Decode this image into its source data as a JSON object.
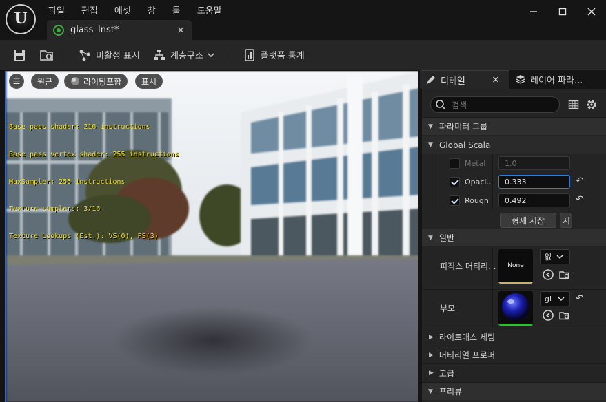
{
  "menu": [
    "파일",
    "편집",
    "에셋",
    "창",
    "툴",
    "도움말"
  ],
  "tab": {
    "title": "glass_Inst*",
    "close": "×"
  },
  "toolbar": {
    "visibility_label": "비활성 표시",
    "hierarchy_label": "계층구조",
    "platform_stats_label": "플랫폼 통계"
  },
  "viewport": {
    "menu_glyph": "☰",
    "perspective": "원근",
    "lighting": "라이팅포함",
    "show": "표시",
    "stats": [
      "Base pass shader: 216 instructions",
      "Base pass vertex shader: 255 instructions",
      "MaxSampler: 255 instructions",
      "Texture samplers: 3/16",
      "Texture Lookups (Est.): VS(0), PS(3)"
    ]
  },
  "panel": {
    "tabs": {
      "details": "디테일",
      "details_close": "×",
      "layers": "레이어 파라..."
    },
    "search_placeholder": "검색",
    "param_groups": "파라미터 그룹",
    "global_scalar": "Global Scala",
    "params": [
      {
        "name": "Metal",
        "value": "1.0",
        "enabled": false
      },
      {
        "name": "Opaci...",
        "value": "0.333",
        "enabled": true
      },
      {
        "name": "Rough",
        "value": "0.492",
        "enabled": true
      }
    ],
    "save_sibling": "형제 저장",
    "save_child_partial": "지",
    "general": "일반",
    "physical_material_label": "피직스 머티리...",
    "physical_material_thumb": "None",
    "physical_material_combo": "없",
    "parent_label": "부모",
    "parent_combo": "gl",
    "collapsed_sections": [
      "라이트매스 세팅",
      "머티리얼 프로퍼",
      "고급"
    ],
    "preview": "프리뷰"
  }
}
